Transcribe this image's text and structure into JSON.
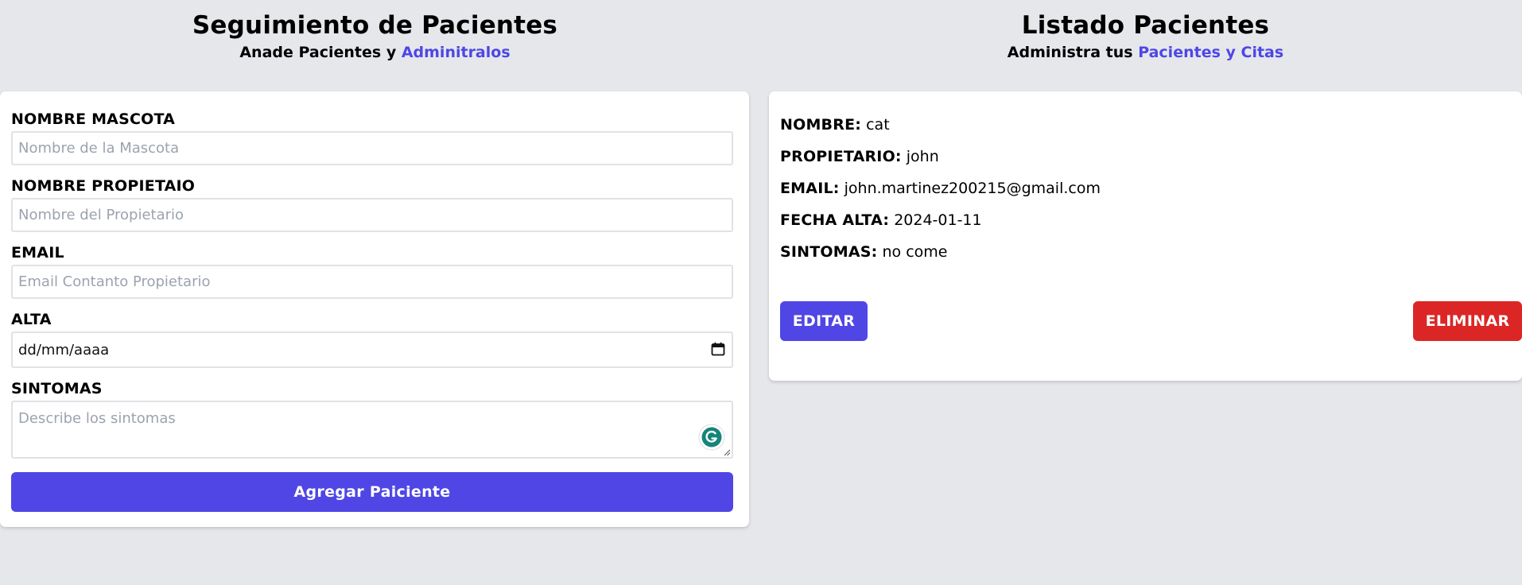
{
  "form_section": {
    "title": "Seguimiento de Pacientes",
    "subtitle_prefix": "Anade Pacientes y ",
    "subtitle_accent": "Adminitralos",
    "fields": {
      "pet_name": {
        "label": "NOMBRE MASCOTA",
        "placeholder": "Nombre de la Mascota",
        "value": ""
      },
      "owner_name": {
        "label": "NOMBRE PROPIETAIO",
        "placeholder": "Nombre del Propietario",
        "value": ""
      },
      "email": {
        "label": "EMAIL",
        "placeholder": "Email Contanto Propietario",
        "value": ""
      },
      "date": {
        "label": "ALTA",
        "display": "dd/mm/aaaa"
      },
      "symptoms": {
        "label": "SINTOMAS",
        "placeholder": "Describe los sintomas",
        "value": ""
      }
    },
    "submit_label": "Agregar Paiciente"
  },
  "list_section": {
    "title": "Listado Pacientes",
    "subtitle_prefix": "Administra tus ",
    "subtitle_accent": "Pacientes y Citas",
    "patient": {
      "name_label": "NOMBRE:",
      "name": "cat",
      "owner_label": "PROPIETARIO:",
      "owner": "john",
      "email_label": "EMAIL:",
      "email": "john.martinez200215@gmail.com",
      "date_label": "FECHA ALTA:",
      "date": "2024-01-11",
      "symptoms_label": "SINTOMAS:",
      "symptoms": "no come"
    },
    "edit_label": "EDITAR",
    "delete_label": "ELIMINAR"
  },
  "colors": {
    "background": "#e5e7eb",
    "accent": "#4f46e5",
    "danger": "#dc2626",
    "grammarly": "#15847a"
  },
  "icons": {
    "date_picker": "calendar-icon",
    "extension": "grammarly-icon"
  }
}
